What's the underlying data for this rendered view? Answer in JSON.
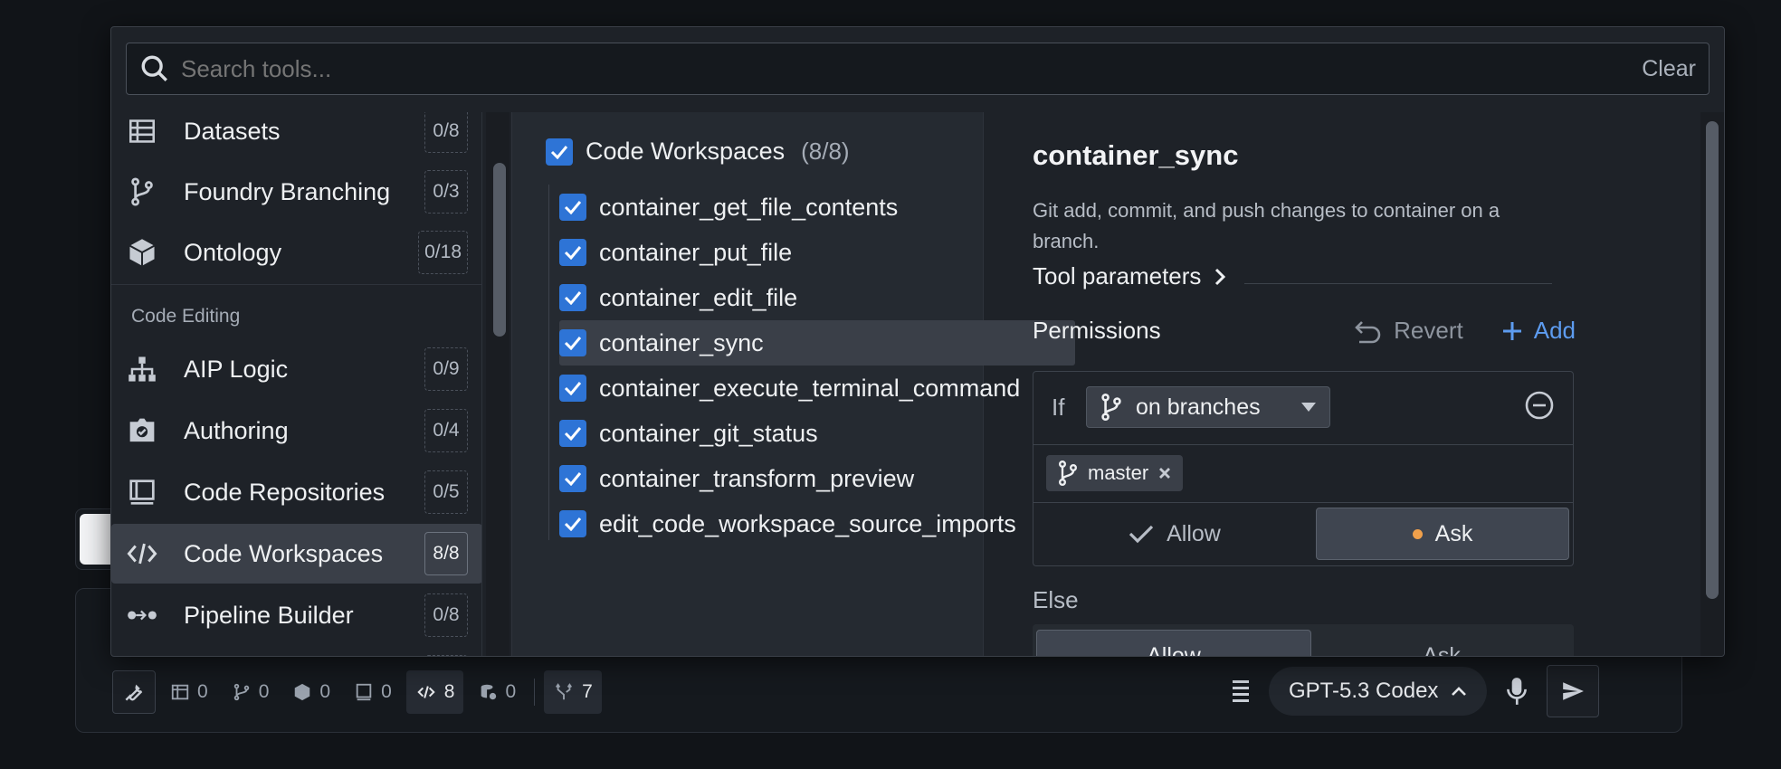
{
  "search": {
    "placeholder": "Search tools...",
    "clear_label": "Clear"
  },
  "sidebar": {
    "items_top": [
      {
        "label": "Datasets",
        "count": "0/8",
        "icon": "table-icon"
      },
      {
        "label": "Foundry Branching",
        "count": "0/3",
        "icon": "git-branch-icon"
      },
      {
        "label": "Ontology",
        "count": "0/18",
        "icon": "cube-icon"
      }
    ],
    "section": "Code Editing",
    "items_code": [
      {
        "label": "AIP Logic",
        "count": "0/9",
        "icon": "hierarchy-icon"
      },
      {
        "label": "Authoring",
        "count": "0/4",
        "icon": "authoring-icon"
      },
      {
        "label": "Code Repositories",
        "count": "0/5",
        "icon": "book-icon"
      },
      {
        "label": "Code Workspaces",
        "count": "8/8",
        "icon": "code-icon",
        "active": true
      },
      {
        "label": "Pipeline Builder",
        "count": "0/8",
        "icon": "pipeline-icon"
      }
    ]
  },
  "group": {
    "label": "Code Workspaces",
    "count": "(8/8)"
  },
  "tools": [
    "container_get_file_contents",
    "container_put_file",
    "container_edit_file",
    "container_sync",
    "container_execute_terminal_command",
    "container_git_status",
    "container_transform_preview",
    "edit_code_workspace_source_imports"
  ],
  "detail": {
    "title": "container_sync",
    "description": "Git add, commit, and push changes to container on a branch.",
    "params_label": "Tool parameters",
    "permissions_label": "Permissions",
    "revert_label": "Revert",
    "add_label": "Add",
    "rule": {
      "if_label": "If",
      "condition": "on branches",
      "tag": "master",
      "allow_label": "Allow",
      "ask_label": "Ask"
    },
    "else_label": "Else",
    "else_allow": "Allow",
    "else_ask": "Ask"
  },
  "bottom_bar": {
    "counts": [
      {
        "icon": "table-icon",
        "value": "0"
      },
      {
        "icon": "git-branch-icon",
        "value": "0"
      },
      {
        "icon": "cube-icon",
        "value": "0"
      },
      {
        "icon": "book-icon",
        "value": "0"
      },
      {
        "icon": "code-icon",
        "value": "8",
        "active": true
      },
      {
        "icon": "database-icon",
        "value": "0"
      }
    ],
    "merge_count": "7",
    "model": "GPT-5.3 Codex"
  },
  "colors": {
    "accent": "#2e74d6",
    "link": "#5d9cf0",
    "ask_dot": "#f0a04b"
  }
}
